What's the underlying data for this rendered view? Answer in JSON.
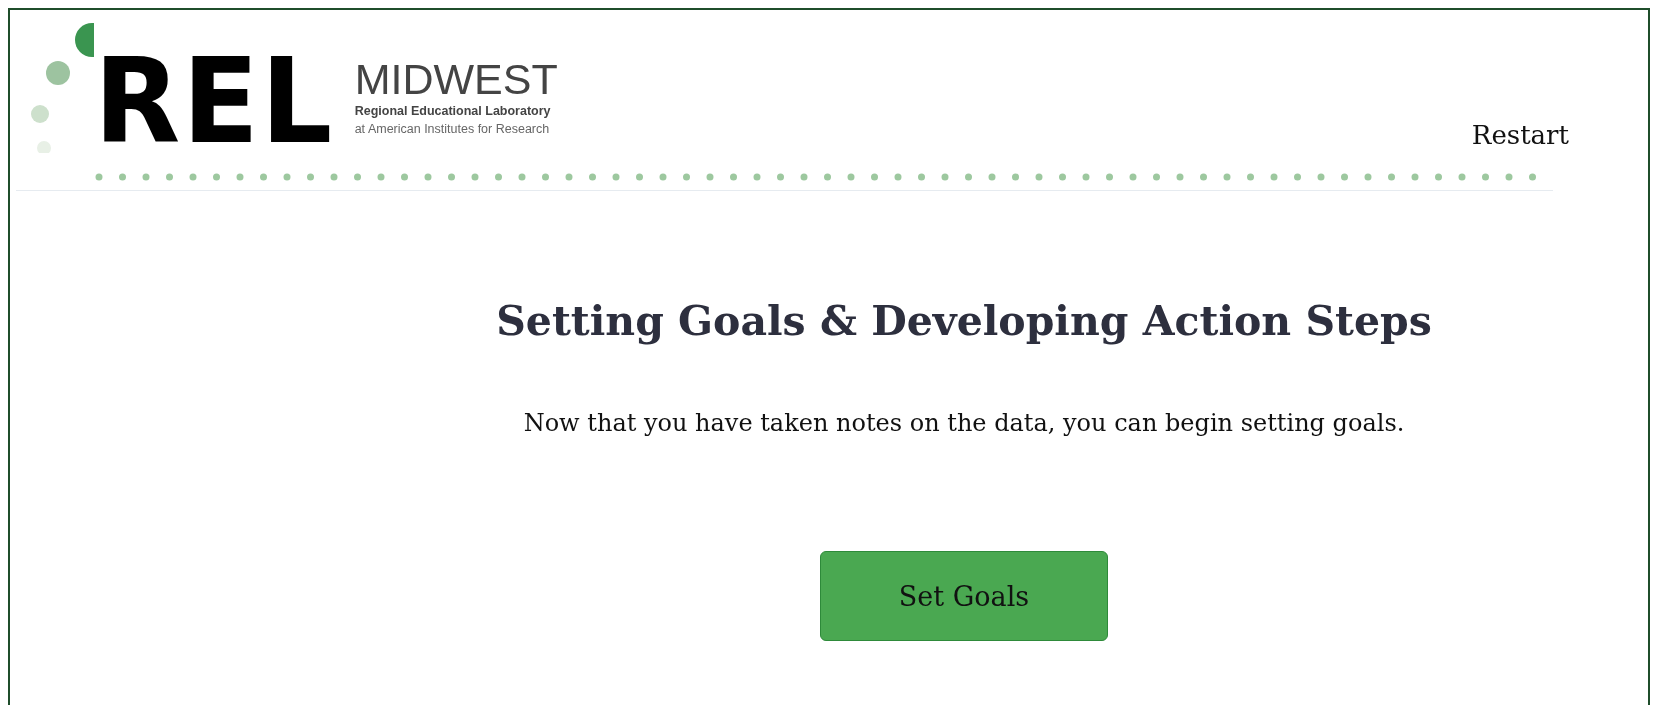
{
  "header": {
    "logo": {
      "mark": "REL",
      "name": "MIDWEST",
      "line_1": "Regional Educational Laboratory",
      "line_2": "at American Institutes for Research"
    },
    "restart_link": "Restart"
  },
  "main": {
    "title": "Setting Goals & Developing Action Steps",
    "intro": "Now that you have taken notes on the data, you can begin setting goals.",
    "button": "Set Goals"
  }
}
